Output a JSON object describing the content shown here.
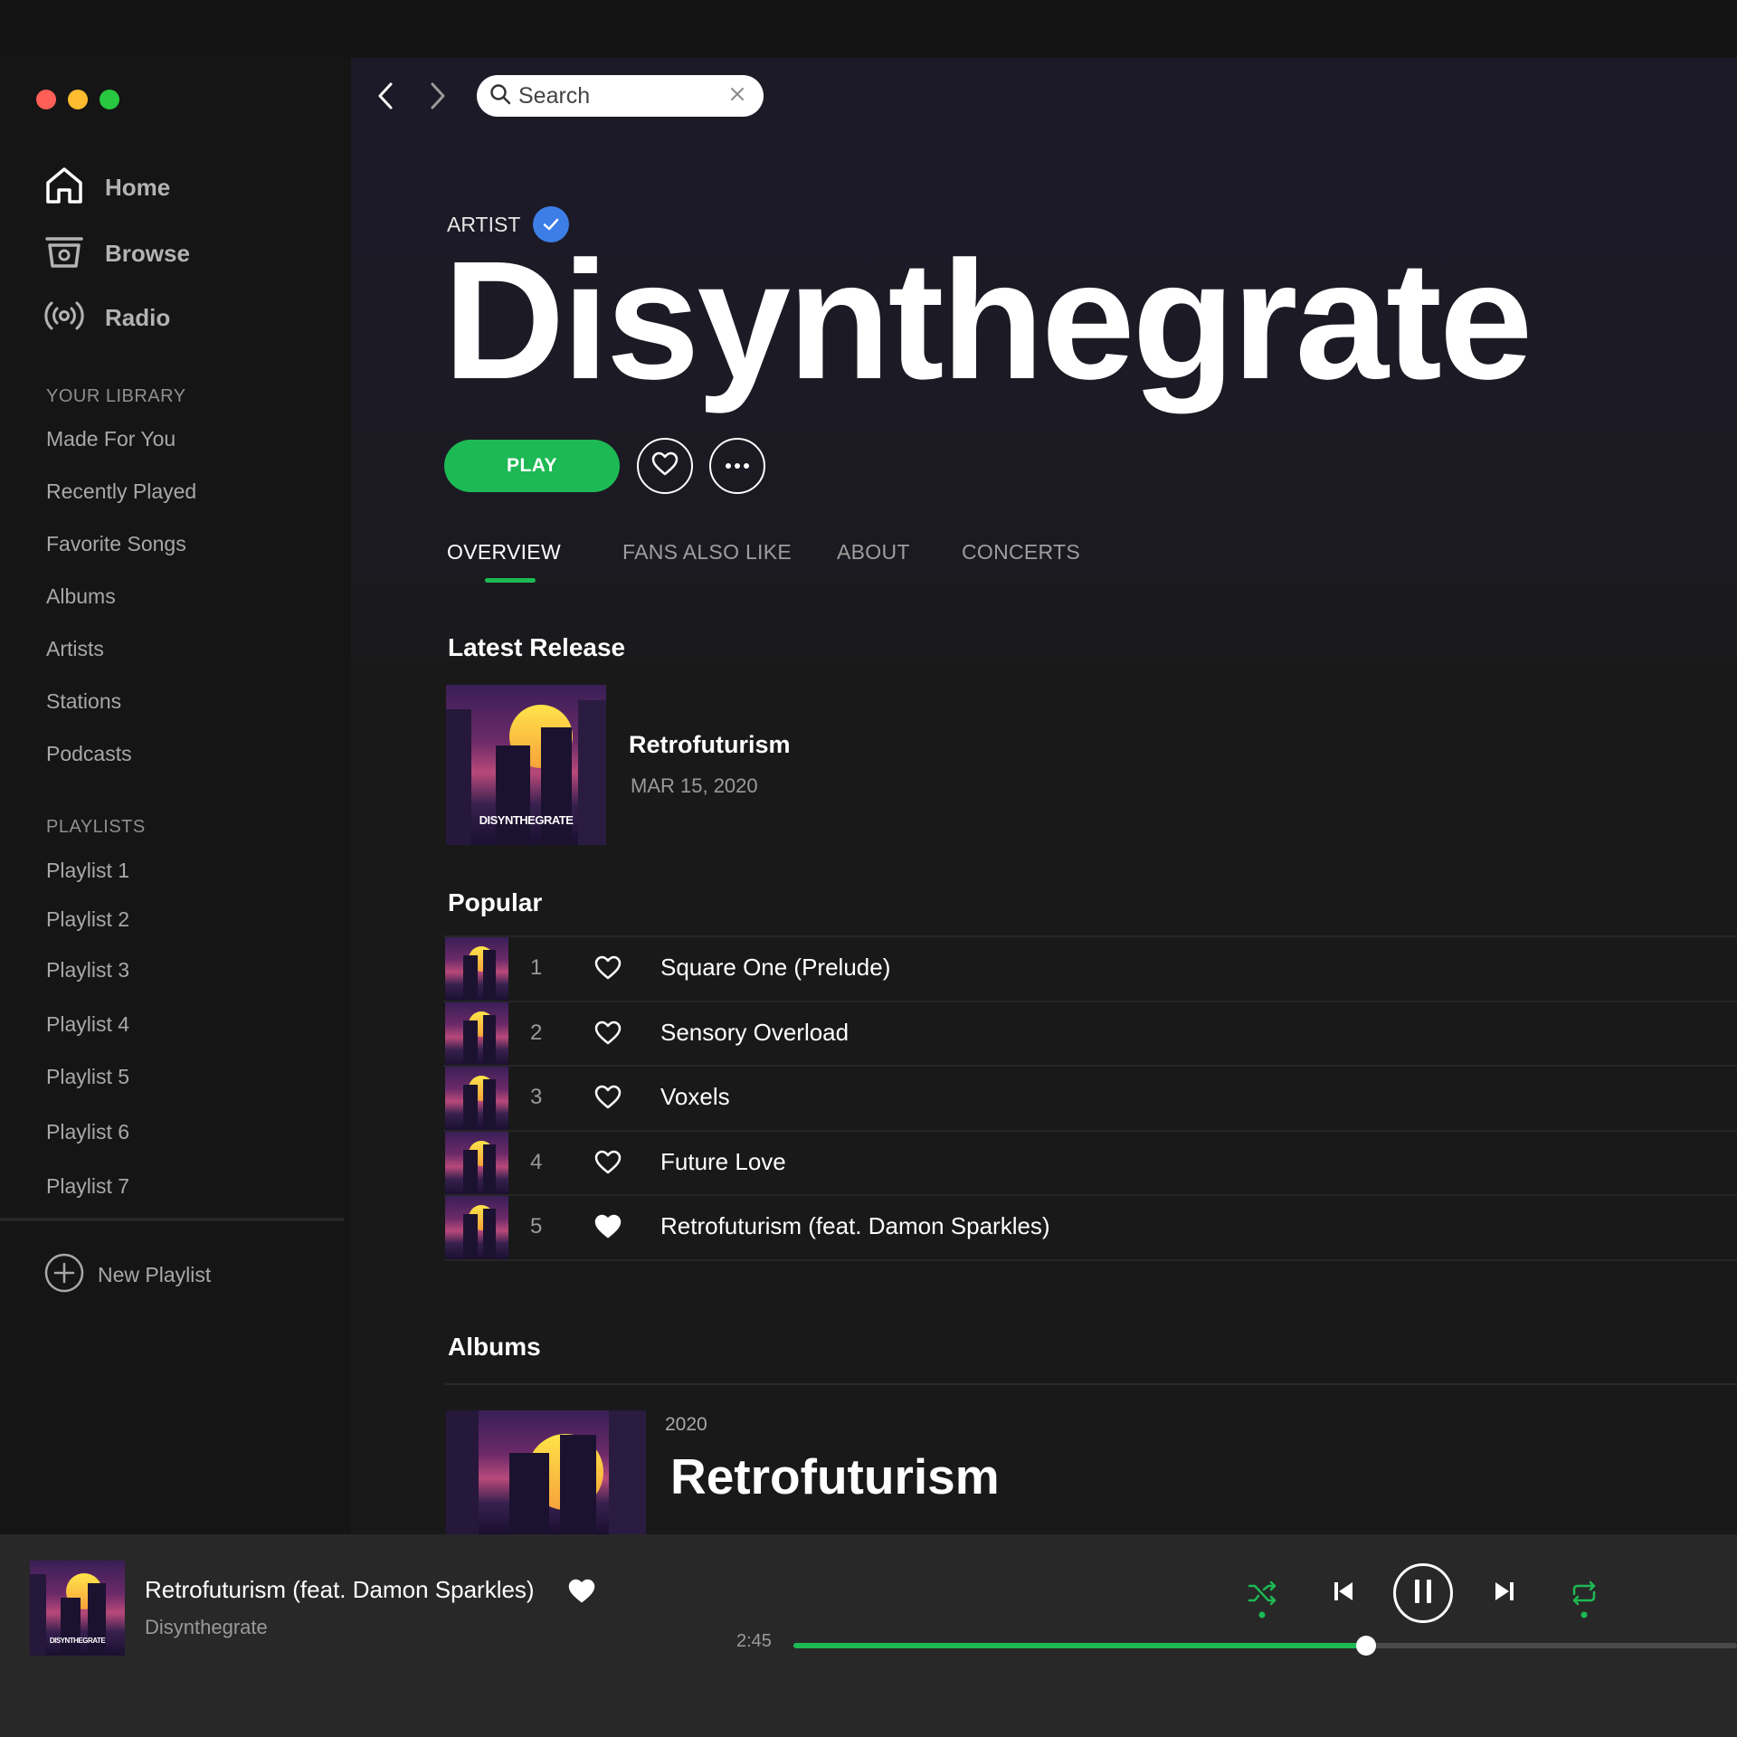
{
  "window": {
    "colors": {
      "close": "#ff5f57",
      "minimize": "#febc2e",
      "maximize": "#28c840"
    }
  },
  "sidebar": {
    "nav": [
      {
        "label": "Home",
        "icon": "home-icon"
      },
      {
        "label": "Browse",
        "icon": "browse-icon"
      },
      {
        "label": "Radio",
        "icon": "radio-icon"
      }
    ],
    "library_heading": "YOUR LIBRARY",
    "library": [
      "Made For You",
      "Recently Played",
      "Favorite Songs",
      "Albums",
      "Artists",
      "Stations",
      "Podcasts"
    ],
    "playlists_heading": "PLAYLISTS",
    "playlists": [
      "Playlist 1",
      "Playlist 2",
      "Playlist 3",
      "Playlist 4",
      "Playlist 5",
      "Playlist 6",
      "Playlist 7"
    ],
    "new_playlist": "New Playlist"
  },
  "search": {
    "placeholder": "Search"
  },
  "artist": {
    "tag": "ARTIST",
    "name": "Disynthegrate",
    "play_label": "PLAY"
  },
  "tabs": [
    "OVERVIEW",
    "FANS ALSO LIKE",
    "ABOUT",
    "CONCERTS"
  ],
  "active_tab": "OVERVIEW",
  "latest_release": {
    "heading": "Latest Release",
    "title": "Retrofuturism",
    "date": "MAR 15, 2020",
    "cover_text": "DISYNTHEGRATE"
  },
  "popular": {
    "heading": "Popular",
    "tracks": [
      {
        "num": "1",
        "title": "Square One (Prelude)",
        "liked": false
      },
      {
        "num": "2",
        "title": "Sensory Overload",
        "liked": false
      },
      {
        "num": "3",
        "title": "Voxels",
        "liked": false
      },
      {
        "num": "4",
        "title": "Future Love",
        "liked": false
      },
      {
        "num": "5",
        "title": "Retrofuturism (feat. Damon Sparkles)",
        "liked": true
      }
    ]
  },
  "albums": {
    "heading": "Albums",
    "items": [
      {
        "year": "2020",
        "title": "Retrofuturism"
      }
    ]
  },
  "player": {
    "title": "Retrofuturism (feat. Damon Sparkles)",
    "artist": "Disynthegrate",
    "liked": true,
    "elapsed": "2:45",
    "progress": 0.607,
    "accent": "#1db954"
  }
}
